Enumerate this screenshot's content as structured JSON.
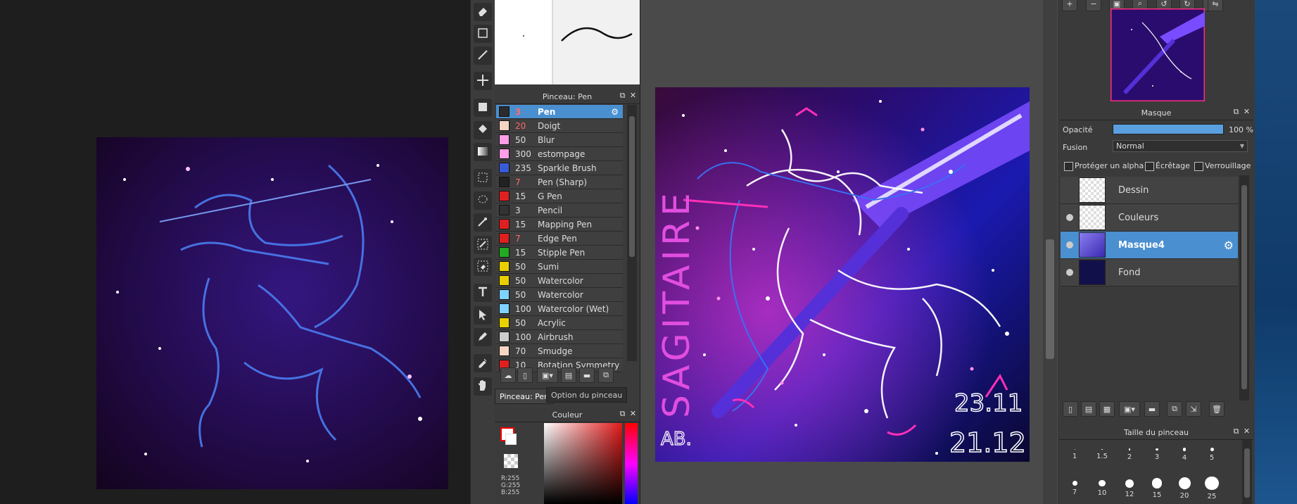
{
  "brush_panel": {
    "title": "Pinceau: Pen",
    "brushes": [
      {
        "size": "3",
        "name": "Pen",
        "color": "#2b2b2b",
        "selected": true,
        "size_color": "#ff6a6a"
      },
      {
        "size": "20",
        "name": "Doigt",
        "color": "#f5d6c3",
        "size_color": "#ff6a6a"
      },
      {
        "size": "50",
        "name": "Blur",
        "color": "#ff9de6",
        "size_color": "#dddddd"
      },
      {
        "size": "300",
        "name": "estompage",
        "color": "#ff9de6",
        "size_color": "#dddddd"
      },
      {
        "size": "235",
        "name": "Sparkle Brush",
        "color": "#3a5bd8",
        "size_color": "#dddddd"
      },
      {
        "size": "7",
        "name": "Pen (Sharp)",
        "color": "#222222",
        "size_color": "#ff6a6a"
      },
      {
        "size": "15",
        "name": "G Pen",
        "color": "#e02020",
        "size_color": "#dddddd"
      },
      {
        "size": "3",
        "name": "Pencil",
        "color": "#333333",
        "size_color": "#dddddd"
      },
      {
        "size": "15",
        "name": "Mapping Pen",
        "color": "#e02020",
        "size_color": "#dddddd"
      },
      {
        "size": "7",
        "name": "Edge Pen",
        "color": "#e02020",
        "size_color": "#ff6a6a"
      },
      {
        "size": "15",
        "name": "Stipple Pen",
        "color": "#22aa22",
        "size_color": "#dddddd"
      },
      {
        "size": "50",
        "name": "Sumi",
        "color": "#e8d000",
        "size_color": "#dddddd"
      },
      {
        "size": "50",
        "name": "Watercolor",
        "color": "#e8d000",
        "size_color": "#dddddd"
      },
      {
        "size": "50",
        "name": "Watercolor",
        "color": "#7ed3ff",
        "size_color": "#dddddd"
      },
      {
        "size": "100",
        "name": "Watercolor (Wet)",
        "color": "#7ed3ff",
        "size_color": "#dddddd"
      },
      {
        "size": "50",
        "name": "Acrylic",
        "color": "#e8d000",
        "size_color": "#dddddd"
      },
      {
        "size": "100",
        "name": "Airbrush",
        "color": "#cccccc",
        "size_color": "#dddddd"
      },
      {
        "size": "70",
        "name": "Smudge",
        "color": "#f5d6c3",
        "size_color": "#dddddd"
      },
      {
        "size": "10",
        "name": "Rotation Symmetry Pen",
        "color": "#e02020",
        "size_color": "#dddddd"
      }
    ],
    "tab_active": "Pinceau: Pen",
    "tab_other": "Option du pinceau"
  },
  "color_panel": {
    "title": "Couleur",
    "rgb_r": "R:255",
    "rgb_g": "G:255",
    "rgb_b": "B:255",
    "foreground": "#ff0000",
    "background": "#ffffff"
  },
  "canvas": {
    "title_text": "SAGITAIRE",
    "date_top": "23.11",
    "date_bottom": "21.12",
    "signature": "AB."
  },
  "layer_panel": {
    "title": "Masque",
    "opacity_label": "Opacité",
    "opacity_value": "100 %",
    "opacity_fraction": 1.0,
    "blend_label": "Fusion",
    "blend_value": "Normal",
    "protect_alpha": "Protéger un alpha",
    "clipping": "Écrêtage",
    "lock": "Verrouillage",
    "layers": [
      {
        "name": "Dessin",
        "visible": false,
        "selected": false
      },
      {
        "name": "Couleurs",
        "visible": true,
        "selected": false
      },
      {
        "name": "Masque4",
        "visible": true,
        "selected": true
      },
      {
        "name": "Fond",
        "visible": true,
        "selected": false
      }
    ]
  },
  "brush_size_panel": {
    "title": "Taille du pinceau",
    "sizes_row1": [
      "1",
      "1.5",
      "2",
      "3",
      "4",
      "5"
    ],
    "sizes_row2": [
      "7",
      "10",
      "12",
      "15",
      "20",
      "25"
    ]
  }
}
